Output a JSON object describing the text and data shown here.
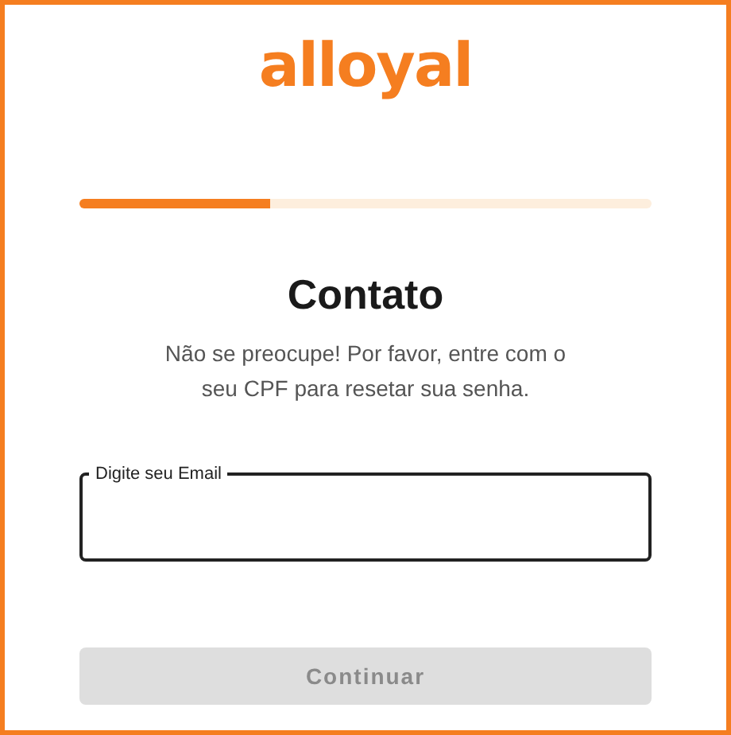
{
  "logo": "alloyal",
  "progress": {
    "level": 0.333
  },
  "title": "Contato",
  "description": "Não se preocupe! Por favor, entre com o seu CPF para resetar sua senha.",
  "email_field": {
    "label": "Digite seu Email"
  },
  "continue_button": {
    "label": "Continuar",
    "disabled": true
  }
}
